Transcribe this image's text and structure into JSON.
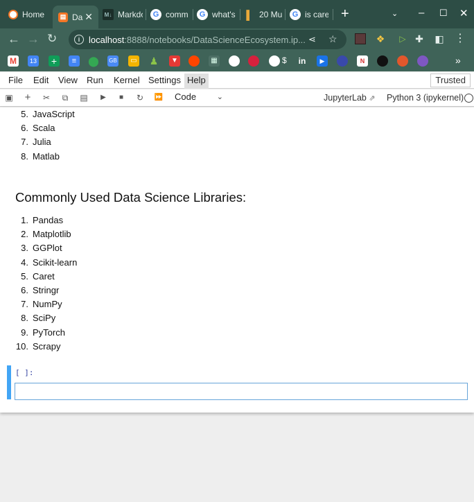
{
  "browser": {
    "tabs": [
      {
        "title": "Home",
        "icon": "jupyter-icon",
        "active": false
      },
      {
        "title": "Da",
        "icon": "jupyter-icon",
        "active": true
      },
      {
        "title": "Markdo",
        "icon": "markdown-icon",
        "active": false
      },
      {
        "title": "comm",
        "icon": "google-icon",
        "active": false
      },
      {
        "title": "what's",
        "icon": "google-icon",
        "active": false
      },
      {
        "title": "20 Mu",
        "icon": "chart-icon",
        "active": false
      },
      {
        "title": "is care",
        "icon": "google-icon",
        "active": false
      }
    ],
    "address": {
      "host": "localhost",
      "rest": ":8888/notebooks/DataScienceEcosystem.ip..."
    },
    "colors": {
      "frame": "#2d4d45",
      "toolbar": "#3f6358",
      "accent": "#f37626"
    }
  },
  "menubar": {
    "items": [
      "File",
      "Edit",
      "View",
      "Run",
      "Kernel",
      "Settings",
      "Help"
    ],
    "active": "Help",
    "trusted_label": "Trusted"
  },
  "nbtoolbar": {
    "cell_type": "Code",
    "jupyterlab_label": "JupyterLab",
    "kernel_label": "Python 3 (ipykernel)"
  },
  "notebook": {
    "languages_tail": [
      {
        "num": "5.",
        "text": "JavaScript"
      },
      {
        "num": "6.",
        "text": "Scala"
      },
      {
        "num": "7.",
        "text": "Julia"
      },
      {
        "num": "8.",
        "text": "Matlab"
      }
    ],
    "libraries_heading": "Commonly Used Data Science Libraries:",
    "libraries": [
      {
        "num": "1.",
        "text": "Pandas"
      },
      {
        "num": "2.",
        "text": "Matplotlib"
      },
      {
        "num": "3.",
        "text": "GGPlot"
      },
      {
        "num": "4.",
        "text": "Scikit-learn"
      },
      {
        "num": "5.",
        "text": "Caret"
      },
      {
        "num": "6.",
        "text": "Stringr"
      },
      {
        "num": "7.",
        "text": "NumPy"
      },
      {
        "num": "8.",
        "text": "SciPy"
      },
      {
        "num": "9.",
        "text": "PyTorch"
      },
      {
        "num": "10.",
        "text": "Scrapy"
      }
    ],
    "empty_cell_prompt": "[ ]:",
    "empty_cell_value": ""
  }
}
